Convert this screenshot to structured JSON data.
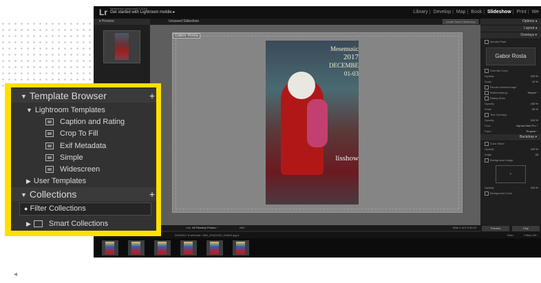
{
  "app": {
    "logo": "Lr",
    "identity_line1": "Slideshow/Lightroom5CC2015",
    "identity_line2": "Get started with Lightroom mobile ▸",
    "modules": [
      "Library",
      "Develop",
      "Map",
      "Book",
      "Slideshow",
      "Print",
      "We"
    ],
    "module_separator": "|",
    "active_module": "Slideshow"
  },
  "left_panel": {
    "preview_label": "▾ Preview"
  },
  "center": {
    "unsaved_label": "Unsaved Slideshow",
    "create_saved_label": "Create Saved Slideshow",
    "identity_plate_text": "Gabor Rosta",
    "photo_text_line1": "Mesemusic",
    "photo_text_line2": "2017",
    "photo_text_line3": "DECEMBE",
    "photo_text_line4": "01-03",
    "photo_watermark": "lisshow"
  },
  "right_panel": {
    "options": "Options ◂",
    "layout": "Layout ◂",
    "overlays": "Overlays ▾",
    "identity_plate": "Identity Plate",
    "identity_name": "Gabor Rosta",
    "override_color": "Override Color",
    "opacity_label": "Opacity",
    "opacity_val": "100 %",
    "scale_label": "Scale",
    "scale_val": "10 %",
    "render_behind": "Render behind image",
    "watermarking": "Watermarking :",
    "watermarking_val": "Simple ÷",
    "rating_stars": "Rating Stars",
    "rating_opacity_val": "100 %",
    "rating_scale_val": "25 %",
    "text_overlays": "Text Overlays",
    "text_opacity_label": "Opacity",
    "text_opacity_val": "100 %",
    "font_label": "Font :",
    "font_val": "Myriad Web Pro ÷",
    "face_label": "Face :",
    "face_val": "Regular ÷",
    "backdrop": "Backdrop ▾",
    "color_wash": "Color Wash",
    "cw_opacity_val": "100 %",
    "angle_label": "Angle",
    "angle_val": "45",
    "background_image": "Background Image",
    "bg_plus": "+",
    "bg_opacity_val": "100 %",
    "background_color": "Background Color",
    "preview_btn": "Preview",
    "play_btn": "Play"
  },
  "toolbar": {
    "use_label": "Use:",
    "use_value": "All Filmstrip Photos ÷",
    "abc": "ABC",
    "slide_count": "Slide 1 of 6  0:00:43"
  },
  "filmbar": {
    "path": "2016033 / 6 selected / IMG_20161203_154618.jpg ▾",
    "filter_label": "Filter :",
    "filter_value": "Filters Off ÷"
  },
  "callout": {
    "template_browser": "Template Browser",
    "lightroom_templates": "Lightroom Templates",
    "templates": [
      "Caption and Rating",
      "Crop To Fill",
      "Exif Metadata",
      "Simple",
      "Widescreen"
    ],
    "user_templates": "User Templates",
    "collections": "Collections",
    "filter_collections": "Filter Collections",
    "smart_collections": "Smart Collections",
    "plus": "+",
    "expanded_arrow": "▼",
    "collapsed_arrow": "▶",
    "side_tab": "◂"
  },
  "colors": {
    "highlight": "#ffe000",
    "panel_bg": "#323232",
    "app_bg": "#262626"
  }
}
